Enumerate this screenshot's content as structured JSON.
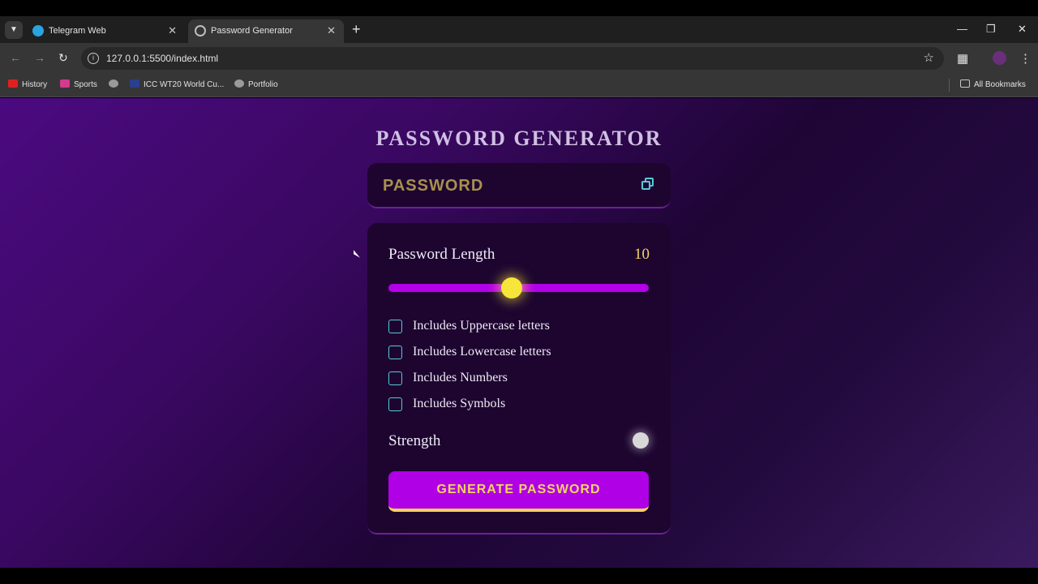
{
  "browser": {
    "tabs": [
      {
        "title": "Telegram Web",
        "active": false
      },
      {
        "title": "Password Generator",
        "active": true
      }
    ],
    "url": "127.0.0.1:5500/index.html",
    "bookmarks": [
      {
        "label": "History",
        "color": "#e02020"
      },
      {
        "label": "Sports",
        "color": "#d43a8e"
      },
      {
        "label": "",
        "color": "#9a9a9a"
      },
      {
        "label": "ICC WT20 World Cu...",
        "color": "#2a3f8f"
      },
      {
        "label": "Portfolio",
        "color": "#9a9a9a"
      }
    ],
    "all_bookmarks": "All Bookmarks"
  },
  "app": {
    "title": "PASSWORD GENERATOR",
    "password_placeholder": "PASSWORD",
    "length_label": "Password Length",
    "length_value": "10",
    "slider": {
      "min": 1,
      "max": 20,
      "value": 10
    },
    "options": [
      {
        "label": "Includes Uppercase letters",
        "checked": false
      },
      {
        "label": "Includes Lowercase letters",
        "checked": false
      },
      {
        "label": "Includes Numbers",
        "checked": false
      },
      {
        "label": "Includes Symbols",
        "checked": false
      }
    ],
    "strength_label": "Strength",
    "generate_label": "GENERATE PASSWORD"
  },
  "colors": {
    "accent": "#b000e6",
    "highlight": "#f4d35e",
    "checkbox_border": "#58c9d8",
    "card_bg": "#1d0530"
  }
}
